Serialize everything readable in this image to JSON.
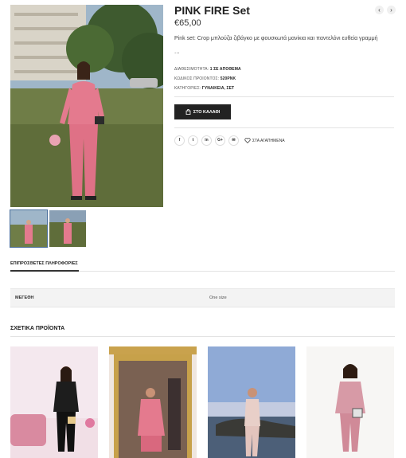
{
  "product": {
    "title": "PINK FIRE Set",
    "price": "€65,00",
    "description": "Pink set: Crop μπλούζα ζιβάγκο με φουσκωτά μανίκια και παντελόνι ευθεία γραμμή",
    "ellipsis": "...",
    "availability_label": "ΔΙΑΘΕΣΙΜΟΤΗΤΑ:",
    "availability_value": "1 ΣΕ ΑΠΟΘΕΜΑ",
    "sku_label": "ΚΩΔΙΚΟΣ ΠΡΟΙΟΝΤΟΣ:",
    "sku_value": "520PNK",
    "categories_label": "ΚΑΤΗΓΟΡΙΕΣ:",
    "categories_value": "ΓΥΝΑΙΚΕΙΑ, ΣΕΤ",
    "add_to_cart": "ΣΤΟ ΚΑΛΑΘΙ",
    "wishlist": "ΣΤΑ ΑΓΑΠΗΜΕΝΑ"
  },
  "share_icons": [
    {
      "name": "facebook-icon",
      "glyph": "f"
    },
    {
      "name": "twitter-icon",
      "glyph": "t"
    },
    {
      "name": "linkedin-icon",
      "glyph": "in"
    },
    {
      "name": "google-plus-icon",
      "glyph": "G+"
    },
    {
      "name": "email-icon",
      "glyph": "✉"
    }
  ],
  "nav": {
    "prev": "‹",
    "next": "›"
  },
  "tabs": {
    "additional_info": "ΕΠΙΠΡΟΣΘΕΤΕΣ ΠΛΗΡΟΦΟΡΙΕΣ"
  },
  "attributes": [
    {
      "name": "ΜΕΓΕΘΗ",
      "value": "One size"
    }
  ],
  "related": {
    "title": "ΣΧΕΤΙΚΑ ΠΡΟΪΟΝΤΑ"
  },
  "colors": {
    "button_bg": "#222222",
    "outfit_pink": "#e47a8e",
    "accent_border": "#4a6f9c"
  }
}
